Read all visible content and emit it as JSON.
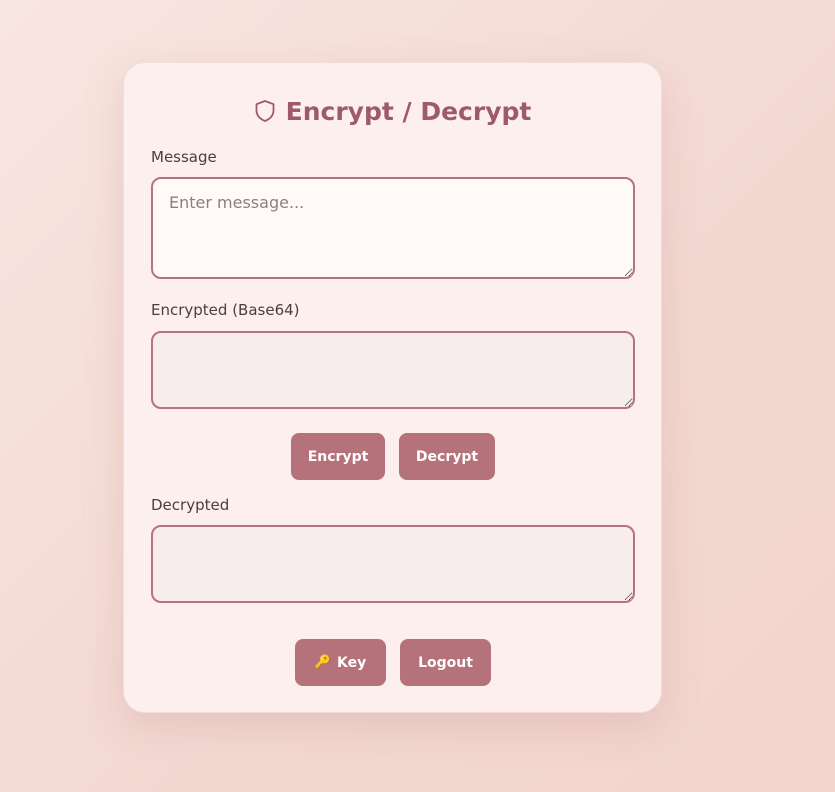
{
  "header": {
    "title": "Encrypt / Decrypt",
    "icon": "shield-icon"
  },
  "message": {
    "label": "Message",
    "placeholder": "Enter message...",
    "value": ""
  },
  "encrypted": {
    "label": "Encrypted (Base64)",
    "value": ""
  },
  "actions": {
    "encrypt_label": "Encrypt",
    "decrypt_label": "Decrypt"
  },
  "decrypted": {
    "label": "Decrypted",
    "value": ""
  },
  "footer": {
    "key_icon": "key-icon",
    "key_glyph": "🔑",
    "key_label": "Key",
    "logout_label": "Logout"
  },
  "colors": {
    "accent": "#b5727b",
    "title": "#9e5a66",
    "border": "#b5737e",
    "card_background": "#fdefee"
  }
}
